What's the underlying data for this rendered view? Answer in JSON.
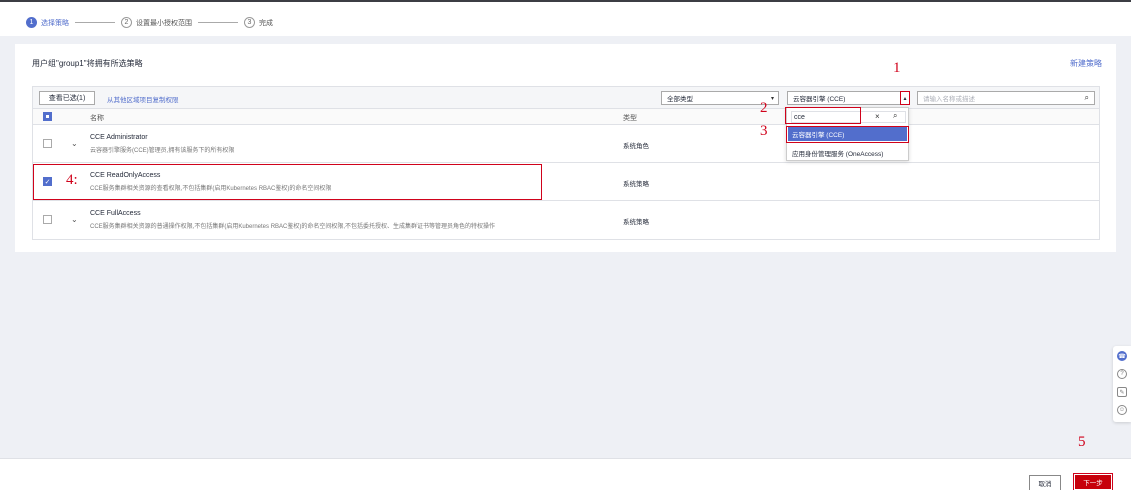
{
  "steps": [
    {
      "num": "1",
      "label": "选择策略"
    },
    {
      "num": "2",
      "label": "设置最小授权范围"
    },
    {
      "num": "3",
      "label": "完成"
    }
  ],
  "panel": {
    "title": "用户组\"group1\"将拥有所选策略",
    "new_policy": "新建策略"
  },
  "toolbar": {
    "view_selected": "查看已选(1)",
    "copy_link": "从其他区域项目复制权限",
    "type_select": "全部类型",
    "service_select": "云容器引擎 (CCE)",
    "search_placeholder": "请输入名称或描述"
  },
  "table": {
    "col_name": "名称",
    "col_type": "类型",
    "rows": [
      {
        "name": "CCE Administrator",
        "desc": "云容器引擎服务(CCE)管理员,拥有该服务下的所有权限",
        "type": "系统角色"
      },
      {
        "name": "CCE ReadOnlyAccess",
        "desc": "CCE服务集群相关资源的查看权限,不包括集群(启用Kubernetes RBAC鉴权)的命名空间权限",
        "type": "系统策略"
      },
      {
        "name": "CCE FullAccess",
        "desc": "CCE服务集群相关资源的普通操作权限,不包括集群(启用Kubernetes RBAC鉴权)的命名空间权限,不包括委托授权、生成集群证书等管理员角色的特权操作",
        "type": "系统策略"
      }
    ]
  },
  "dropdown": {
    "search_value": "cce",
    "options": [
      "云容器引擎 (CCE)",
      "应用身份管理服务 (OneAccess)"
    ]
  },
  "annotations": [
    "1",
    "2",
    "3",
    "4:",
    "5"
  ],
  "footer": {
    "cancel": "取消",
    "next": "下一步"
  },
  "colors": {
    "accent": "#526ecc",
    "highlight_red": "#d0021b",
    "next_button": "#c7000b"
  }
}
